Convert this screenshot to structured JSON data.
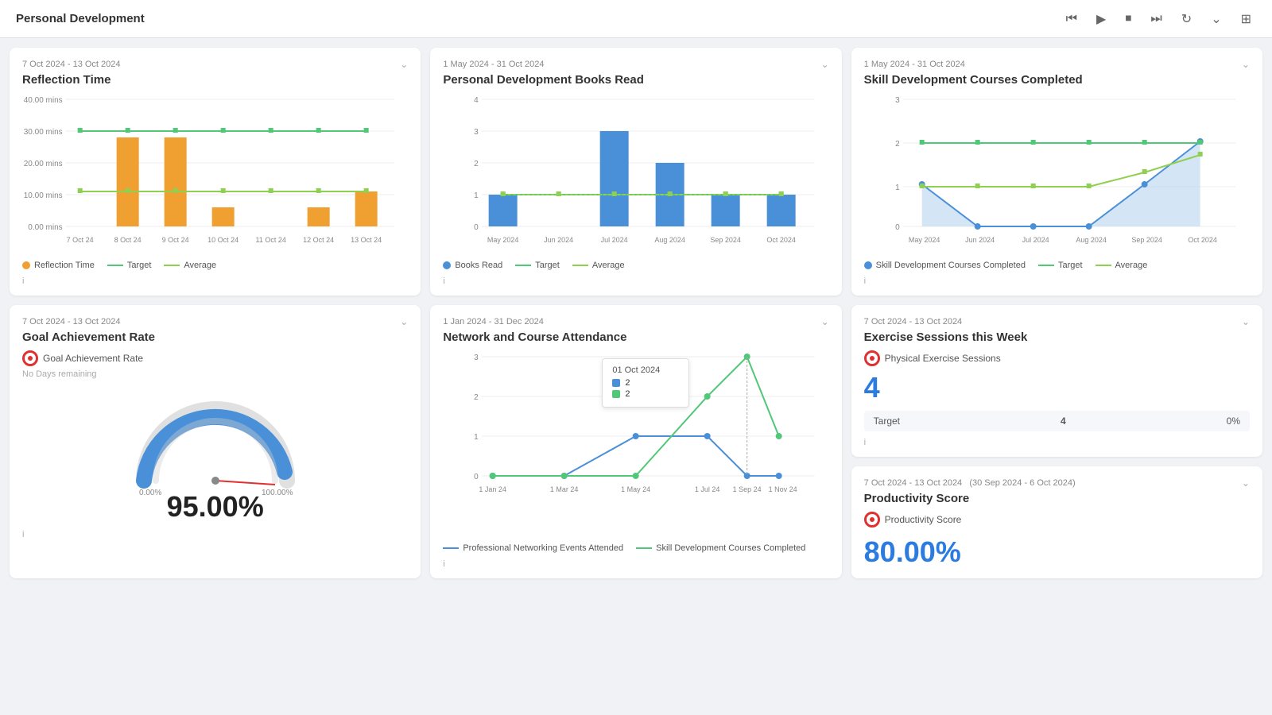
{
  "header": {
    "title": "Personal Development",
    "controls": [
      "skip-back",
      "play",
      "stop",
      "skip-forward",
      "refresh",
      "chevron-down",
      "layout"
    ]
  },
  "cards": [
    {
      "id": "reflection-time",
      "date": "7 Oct 2024 - 13 Oct 2024",
      "title": "Reflection Time",
      "yLabel": "mins",
      "yTicks": [
        "40.00 mins",
        "30.00 mins",
        "20.00 mins",
        "10.00 mins",
        "0.00 mins"
      ],
      "xLabels": [
        "7 Oct 24",
        "8 Oct 24",
        "9 Oct 24",
        "10 Oct 24",
        "11 Oct 24",
        "12 Oct 24",
        "13 Oct 24"
      ],
      "bars": [
        0,
        28,
        28,
        6,
        0,
        6,
        11
      ],
      "target": [
        30,
        30,
        30,
        30,
        30,
        30,
        30
      ],
      "average": [
        11,
        11,
        11,
        11,
        11,
        11,
        11
      ],
      "legend": [
        {
          "label": "Reflection Time",
          "color": "#f0a030",
          "type": "dot"
        },
        {
          "label": "Target",
          "color": "#50c878",
          "type": "line"
        },
        {
          "label": "Average",
          "color": "#90d050",
          "type": "line"
        }
      ]
    },
    {
      "id": "books-read",
      "date": "1 May 2024 - 31 Oct 2024",
      "title": "Personal Development Books Read",
      "yTicks": [
        "4",
        "3",
        "2",
        "1",
        "0"
      ],
      "xLabels": [
        "May 2024",
        "Jun 2024",
        "Jul 2024",
        "Aug 2024",
        "Sep 2024",
        "Oct 2024"
      ],
      "bars": [
        1,
        0,
        3,
        2,
        1,
        1
      ],
      "target": [
        1,
        1,
        1,
        1,
        1,
        1
      ],
      "average": [
        1,
        1,
        1,
        1,
        1,
        1
      ],
      "legend": [
        {
          "label": "Books Read",
          "color": "#4a90d9",
          "type": "dot"
        },
        {
          "label": "Target",
          "color": "#50c878",
          "type": "line"
        },
        {
          "label": "Average",
          "color": "#90d050",
          "type": "line"
        }
      ]
    },
    {
      "id": "skill-courses",
      "date": "1 May 2024 - 31 Oct 2024",
      "title": "Skill Development Courses Completed",
      "yTicks": [
        "3",
        "2",
        "1",
        "0"
      ],
      "xLabels": [
        "May 2024",
        "Jun 2024",
        "Jul 2024",
        "Aug 2024",
        "Sep 2024",
        "Oct 2024"
      ],
      "area": [
        1,
        0,
        0,
        0,
        1,
        2
      ],
      "target": [
        2,
        2,
        2,
        2,
        2,
        2
      ],
      "average": [
        1,
        1,
        1,
        1,
        1.3,
        1.6
      ],
      "legend": [
        {
          "label": "Skill Development Courses Completed",
          "color": "#4a90d9",
          "type": "dot"
        },
        {
          "label": "Target",
          "color": "#50c878",
          "type": "line"
        },
        {
          "label": "Average",
          "color": "#90d050",
          "type": "line"
        }
      ]
    },
    {
      "id": "goal-achievement",
      "date": "7 Oct 2024 - 13 Oct 2024",
      "title": "Goal Achievement Rate",
      "metricLabel": "Goal Achievement Rate",
      "noDays": "No Days remaining",
      "minPct": "0.00%",
      "maxPct": "100.00%",
      "value": "95.00%"
    },
    {
      "id": "network-course",
      "date": "1 Jan 2024 - 31 Dec 2024",
      "title": "Network and Course Attendance",
      "yTicks": [
        "3",
        "2",
        "1",
        "0"
      ],
      "xLabels": [
        "1 Jan 24",
        "1 Mar 24",
        "1 May 24",
        "1 Jul 24",
        "1 Sep 24",
        "1 Nov 24"
      ],
      "networking": [
        0,
        0,
        1,
        1,
        0,
        0
      ],
      "courses": [
        0,
        0,
        0,
        2,
        3,
        1
      ],
      "tooltip": {
        "date": "01 Oct 2024",
        "items": [
          {
            "label": "2",
            "color": "#4a90d9"
          },
          {
            "label": "2",
            "color": "#50c878"
          }
        ]
      },
      "legend": [
        {
          "label": "Professional Networking Events Attended",
          "color": "#4a90d9",
          "type": "line"
        },
        {
          "label": "Skill Development Courses Completed",
          "color": "#50c878",
          "type": "line"
        }
      ]
    },
    {
      "id": "exercise-sessions",
      "date": "7 Oct 2024 - 13 Oct 2024",
      "title": "Exercise Sessions this Week",
      "metricLabel": "Physical Exercise Sessions",
      "value": "4",
      "targetLabel": "Target",
      "targetValue": "4",
      "targetPct": "0%"
    },
    {
      "id": "productivity-score",
      "date": "7 Oct 2024 - 13 Oct 2024",
      "dateExtra": "(30 Sep 2024 - 6 Oct 2024)",
      "title": "Productivity Score",
      "metricLabel": "Productivity Score",
      "value": "80.00%"
    }
  ]
}
